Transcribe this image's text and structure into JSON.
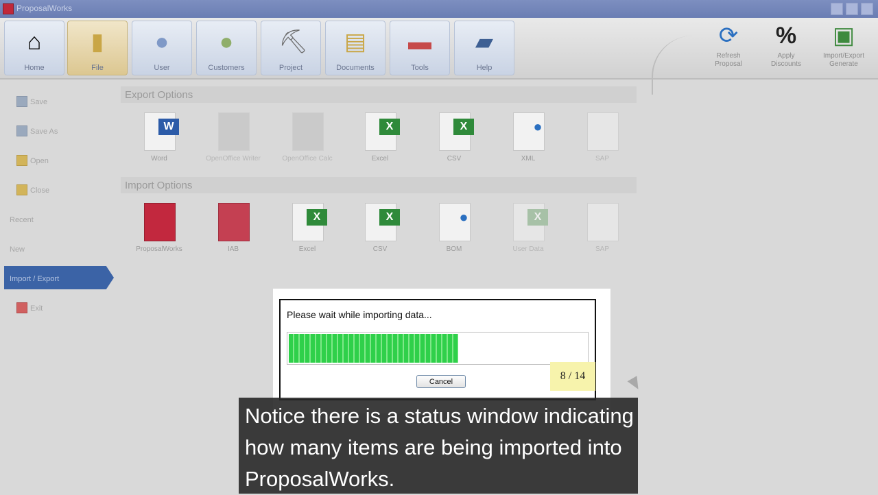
{
  "window": {
    "title": "ProposalWorks"
  },
  "ribbon": {
    "tabs": [
      {
        "label": "Home"
      },
      {
        "label": "File"
      },
      {
        "label": "User"
      },
      {
        "label": "Customers"
      },
      {
        "label": "Project"
      },
      {
        "label": "Documents"
      },
      {
        "label": "Tools"
      },
      {
        "label": "Help"
      }
    ],
    "active_tab": "File",
    "tools": [
      {
        "label": "Refresh\nProposal"
      },
      {
        "label": "Apply\nDiscounts"
      },
      {
        "label": "Import/Export\nGenerate"
      }
    ]
  },
  "sidebar": {
    "items": [
      {
        "label": "Save"
      },
      {
        "label": "Save As"
      },
      {
        "label": "Open"
      },
      {
        "label": "Close"
      },
      {
        "label": "Recent"
      },
      {
        "label": "New"
      },
      {
        "label": "Import / Export"
      },
      {
        "label": "Exit"
      }
    ],
    "selected": "Import / Export"
  },
  "export_options": {
    "title": "Export Options",
    "items": [
      {
        "label": "Word"
      },
      {
        "label": "OpenOffice Writer"
      },
      {
        "label": "OpenOffice Calc"
      },
      {
        "label": "Excel"
      },
      {
        "label": "CSV"
      },
      {
        "label": "XML"
      },
      {
        "label": "SAP"
      }
    ]
  },
  "import_options": {
    "title": "Import Options",
    "items": [
      {
        "label": "ProposalWorks"
      },
      {
        "label": "IAB"
      },
      {
        "label": "Excel"
      },
      {
        "label": "CSV"
      },
      {
        "label": "BOM"
      },
      {
        "label": "User Data"
      },
      {
        "label": "SAP"
      }
    ]
  },
  "dialog": {
    "message": "Please wait while importing data...",
    "cancel_label": "Cancel",
    "progress_fraction": 0.57
  },
  "counter": {
    "text": "8 / 14"
  },
  "caption": {
    "text": "Notice there is a status window indicating how many items are being imported into ProposalWorks."
  },
  "colors": {
    "progress": "#2fd04a",
    "selected_nav": "#3b63a6",
    "counter_bg": "#f7f3ac"
  }
}
